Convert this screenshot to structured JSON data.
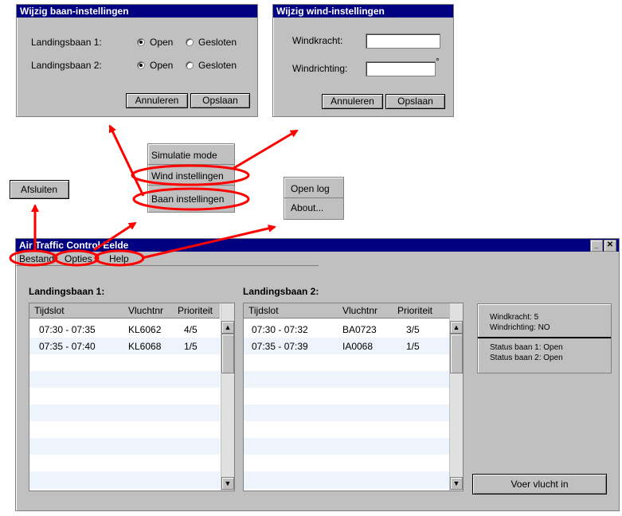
{
  "runway_dialog": {
    "title": "Wijzig baan-instellingen",
    "runway1_label": "Landingsbaan 1:",
    "runway2_label": "Landingsbaan 2:",
    "open_label": "Open",
    "closed_label": "Gesloten",
    "cancel": "Annuleren",
    "save": "Opslaan"
  },
  "wind_dialog": {
    "title": "Wijzig wind-instellingen",
    "force_label": "Windkracht:",
    "direction_label": "Windrichting:",
    "force_value": "",
    "direction_value": "",
    "degree_symbol": "°",
    "cancel": "Annuleren",
    "save": "Opslaan"
  },
  "options_menu": {
    "items": [
      "Simulatie mode",
      "Wind instellingen",
      "Baan instellingen"
    ]
  },
  "help_menu": {
    "items": [
      "Open log",
      "About..."
    ]
  },
  "file_menu": {
    "items": [
      "Afsluiten"
    ]
  },
  "main_window": {
    "title": "Air Traffic Control Eelde",
    "menubar": [
      "Bestand",
      "Opties",
      "Help"
    ],
    "runway1_title": "Landingsbaan 1:",
    "runway2_title": "Landingsbaan 2:",
    "columns": [
      "Tijdslot",
      "Vluchtnr",
      "Prioriteit"
    ],
    "runway1_rows": [
      {
        "slot": "07:30 - 07:35",
        "flight": "KL6062",
        "priority": "4/5"
      },
      {
        "slot": "07:35 - 07:40",
        "flight": "KL6068",
        "priority": "1/5"
      }
    ],
    "runway2_rows": [
      {
        "slot": "07:30 - 07:32",
        "flight": "BA0723",
        "priority": "3/5"
      },
      {
        "slot": "07:35 - 07:39",
        "flight": "IA0068",
        "priority": "1/5"
      }
    ],
    "info": {
      "wind_force": "Windkracht: 5",
      "wind_direction": "Windrichting: NO",
      "status1": "Status baan 1: Open",
      "status2": "Status baan 2: Open"
    },
    "enter_flight": "Voer vlucht in"
  },
  "colors": {
    "annotation": "#ff0000",
    "titlebar": "#000080",
    "window": "#c0c0c0"
  }
}
